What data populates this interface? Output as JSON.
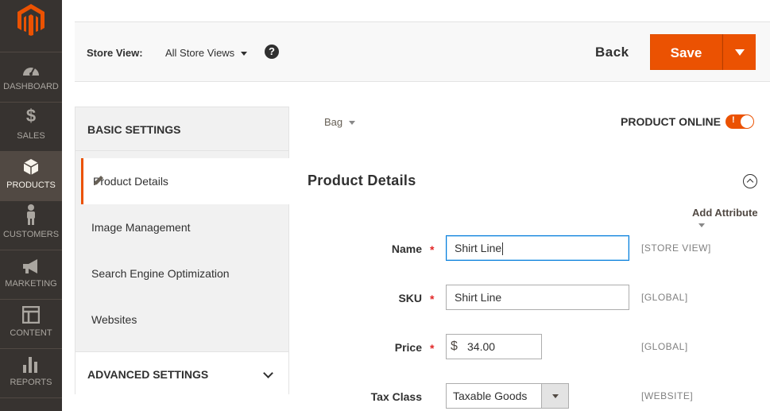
{
  "colors": {
    "accent": "#eb5202",
    "nav_bg": "#373330",
    "nav_active": "#514943"
  },
  "nav": {
    "items": [
      {
        "label": "DASHBOARD",
        "icon": "dashboard-gauge-icon",
        "glyph": "◔"
      },
      {
        "label": "SALES",
        "icon": "dollar-icon",
        "glyph": "$"
      },
      {
        "label": "PRODUCTS",
        "icon": "box-icon",
        "glyph": "⬢"
      },
      {
        "label": "CUSTOMERS",
        "icon": "person-icon",
        "glyph": "♟"
      },
      {
        "label": "MARKETING",
        "icon": "megaphone-icon",
        "glyph": "📢"
      },
      {
        "label": "CONTENT",
        "icon": "layout-icon",
        "glyph": "▤"
      },
      {
        "label": "REPORTS",
        "icon": "bar-chart-icon",
        "glyph": "▟"
      }
    ]
  },
  "actions": {
    "store_view_label": "Store View:",
    "store_view_value": "All Store Views",
    "help_glyph": "?",
    "back_label": "Back",
    "save_label": "Save"
  },
  "settings_panel": {
    "basic_heading": "BASIC SETTINGS",
    "tabs": [
      {
        "label": "Product Details"
      },
      {
        "label": "Image Management"
      },
      {
        "label": "Search Engine Optimization"
      },
      {
        "label": "Websites"
      }
    ],
    "advanced_heading": "ADVANCED SETTINGS"
  },
  "main": {
    "attribute_set": "Bag",
    "online_label": "PRODUCT ONLINE",
    "toggle_mark": "!",
    "section_title": "Product Details",
    "add_attribute": "Add Attribute",
    "fields": {
      "name": {
        "label": "Name",
        "value": "Shirt Line",
        "scope": "[STORE VIEW]"
      },
      "sku": {
        "label": "SKU",
        "value": "Shirt Line",
        "scope": "[GLOBAL]"
      },
      "price": {
        "label": "Price",
        "currency": "$",
        "value": "34.00",
        "scope": "[GLOBAL]"
      },
      "tax_class": {
        "label": "Tax Class",
        "value": "Taxable Goods",
        "scope": "[WEBSITE]"
      }
    }
  }
}
